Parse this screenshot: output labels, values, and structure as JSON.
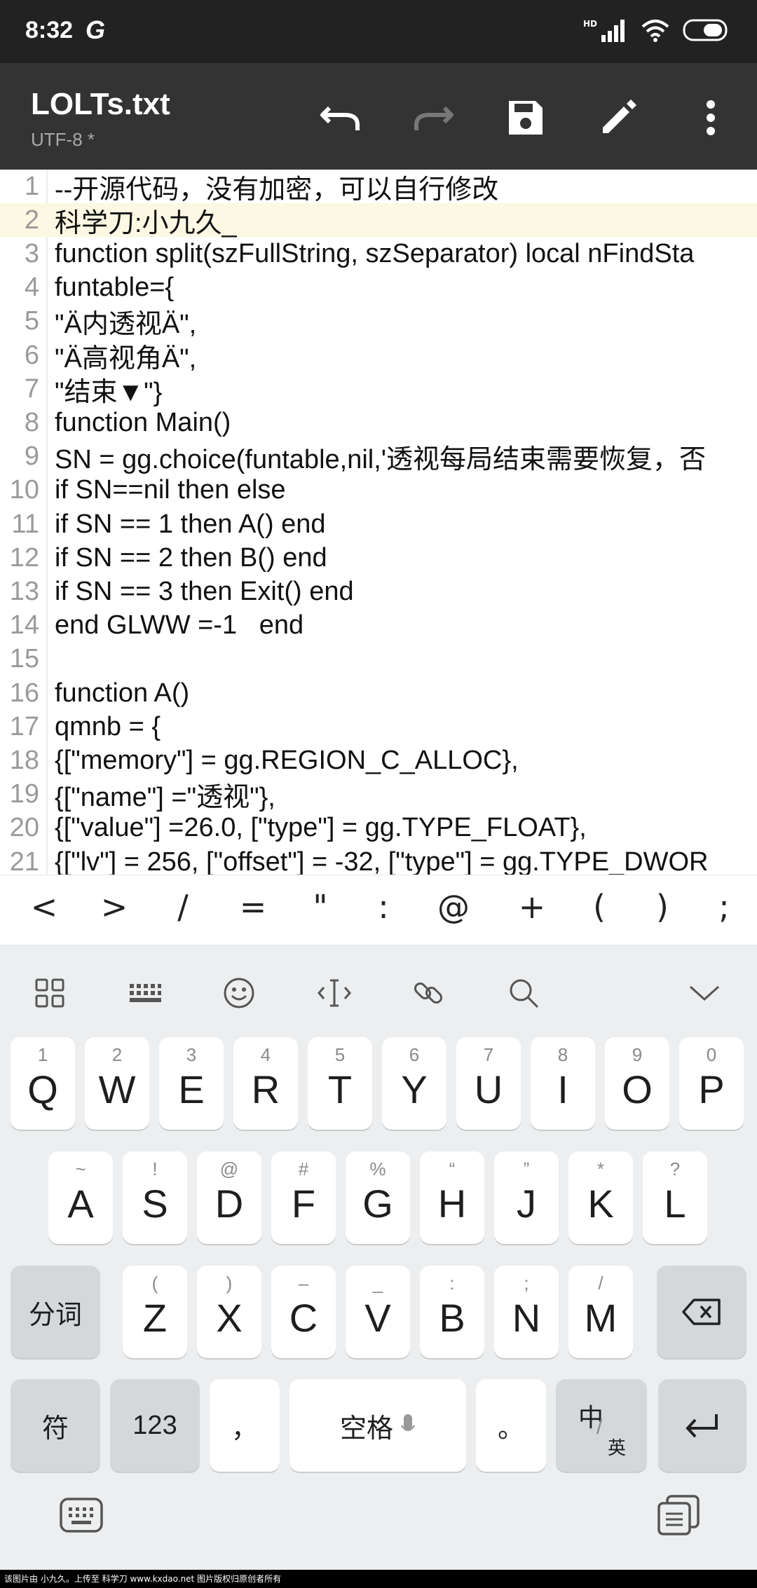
{
  "status_bar": {
    "time": "8:32",
    "carrier_icon": "G",
    "hd": "HD"
  },
  "app_bar": {
    "title": "LOLTs.txt",
    "subtitle": "UTF-8 *"
  },
  "editor": {
    "lines": [
      {
        "n": "1",
        "t": "--开源代码，没有加密，可以自行修改"
      },
      {
        "n": "2",
        "t": "科学刀:小九久_"
      },
      {
        "n": "3",
        "t": "function split(szFullString, szSeparator) local nFindSta"
      },
      {
        "n": "4",
        "t": "funtable={"
      },
      {
        "n": "5",
        "t": "\"Ä内透视Ä\","
      },
      {
        "n": "6",
        "t": "\"Ä高视角Ä\","
      },
      {
        "n": "7",
        "t": "\"结束▼\"}"
      },
      {
        "n": "8",
        "t": "function Main()"
      },
      {
        "n": "9",
        "t": "SN = gg.choice(funtable,nil,'透视每局结束需要恢复，否"
      },
      {
        "n": "10",
        "t": "if SN==nil then else"
      },
      {
        "n": "11",
        "t": "if SN == 1 then A() end"
      },
      {
        "n": "12",
        "t": "if SN == 2 then B() end"
      },
      {
        "n": "13",
        "t": "if SN == 3 then Exit() end"
      },
      {
        "n": "14",
        "t": "end GLWW =-1   end"
      },
      {
        "n": "15",
        "t": ""
      },
      {
        "n": "16",
        "t": "function A()"
      },
      {
        "n": "17",
        "t": "qmnb = {"
      },
      {
        "n": "18",
        "t": "{[\"memory\"] = gg.REGION_C_ALLOC},"
      },
      {
        "n": "19",
        "t": "{[\"name\"] =\"透视\"},"
      },
      {
        "n": "20",
        "t": "{[\"value\"] =26.0, [\"type\"] = gg.TYPE_FLOAT},"
      },
      {
        "n": "21",
        "t": "{[\"lv\"] = 256, [\"offset\"] = -32, [\"type\"] = gg.TYPE_DWOR"
      }
    ],
    "highlight_line": 2
  },
  "symbols": [
    "<",
    ">",
    "/",
    "=",
    "\"",
    ":",
    "@",
    "+",
    "(",
    ")",
    ";"
  ],
  "keyboard": {
    "row1": [
      {
        "k": "Q",
        "h": "1"
      },
      {
        "k": "W",
        "h": "2"
      },
      {
        "k": "E",
        "h": "3"
      },
      {
        "k": "R",
        "h": "4"
      },
      {
        "k": "T",
        "h": "5"
      },
      {
        "k": "Y",
        "h": "6"
      },
      {
        "k": "U",
        "h": "7"
      },
      {
        "k": "I",
        "h": "8"
      },
      {
        "k": "O",
        "h": "9"
      },
      {
        "k": "P",
        "h": "0"
      }
    ],
    "row2": [
      {
        "k": "A",
        "h": "~"
      },
      {
        "k": "S",
        "h": "!"
      },
      {
        "k": "D",
        "h": "@"
      },
      {
        "k": "F",
        "h": "#"
      },
      {
        "k": "G",
        "h": "%"
      },
      {
        "k": "H",
        "h": "“"
      },
      {
        "k": "J",
        "h": "”"
      },
      {
        "k": "K",
        "h": "*"
      },
      {
        "k": "L",
        "h": "?"
      }
    ],
    "row3": [
      {
        "k": "Z",
        "h": "("
      },
      {
        "k": "X",
        "h": ")"
      },
      {
        "k": "C",
        "h": "–"
      },
      {
        "k": "V",
        "h": "_"
      },
      {
        "k": "B",
        "h": ":"
      },
      {
        "k": "N",
        "h": ";"
      },
      {
        "k": "M",
        "h": "/"
      }
    ],
    "segment_label": "分词",
    "symbol_label": "符",
    "number_label": "123",
    "comma_label": "，",
    "space_label": "空格",
    "period_label": "。",
    "lang_top": "中",
    "lang_bottom": "英"
  },
  "footer_text": "该图片由 小九久。上传至 科学刀 www.kxdao.net 图片版权归原创者所有"
}
